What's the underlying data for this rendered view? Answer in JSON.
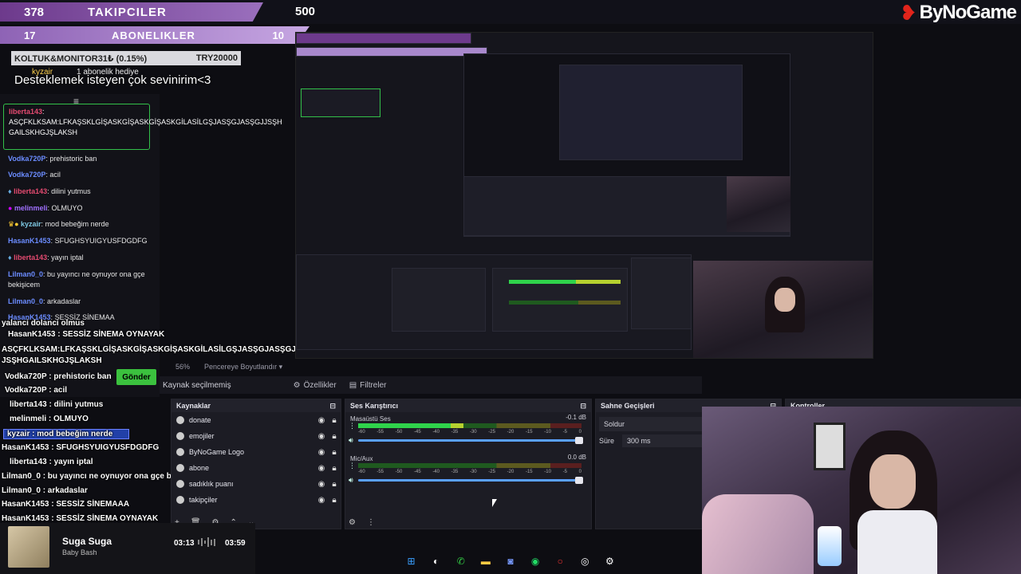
{
  "stats": {
    "followers_count": "378",
    "followers_title": "TAKIPCILER",
    "followers_goal": "500",
    "subs_count": "17",
    "subs_title": "ABONELIKLER",
    "subs_goal": "10"
  },
  "brand": {
    "name": "ByNoGame"
  },
  "donation": {
    "label": "KOLTUK&MONITOR31₺ (0.15%)",
    "target": "TRY20000",
    "message": "Desteklemek isteyen çok sevinirim<3",
    "gift_user": "kyzair",
    "gift_text": "1 abonelik hediye"
  },
  "chat": {
    "highlight": {
      "user": "liberta143",
      "text": "ASÇFKLKSAM:LFKAŞSKLGİŞASKGİŞASKGİŞASKGİLASİLGŞJASŞGJASŞGJJSŞH GAILSKHGJŞLAKSH"
    },
    "lines": [
      {
        "user": "Vodka720P",
        "text": "prehistoric ban"
      },
      {
        "user": "Vodka720P",
        "text": "acil"
      },
      {
        "user": "liberta143",
        "text": "dilini yutmus"
      },
      {
        "user": "melinmeli",
        "text": "OLMUYO"
      },
      {
        "user": "kyzair",
        "text": "mod bebeğim nerde"
      },
      {
        "user": "HasanK1453",
        "text": "SFUGHSYUIGYUSFDGDFG"
      },
      {
        "user": "liberta143",
        "text": "yayın iptal"
      },
      {
        "user": "Lilman0_0",
        "text": "bu yayıncı ne oynuyor ona gçe bekişicem"
      },
      {
        "user": "Lilman0_0",
        "text": "arkadaslar"
      },
      {
        "user": "HasanK1453",
        "text": "SESSİZ SİNEMAA"
      }
    ],
    "overlay": [
      "yalanci dolanci olmus",
      "HasanK1453 : SESSİZ SİNEMA OYNAYAK",
      "ASÇFKLKSAM:LFKAŞSKLGİŞASKGİŞASKGİŞASKGİLASİLGŞJASŞGJASŞGJ",
      "JSŞHGAILSKHGJŞLAKSH",
      "Vodka720P : prehistoric ban",
      "Vodka720P : acil",
      "liberta143 : dilini yutmus",
      "melinmeli : OLMUYO",
      "kyzair : mod bebeğim nerde",
      "HasanK1453 : SFUGHSYUIGYUSFDGDFG",
      "liberta143 : yayın iptal",
      "Lilman0_0 : bu yayıncı ne oynuyor ona gçe bekişicem",
      "Lilman0_0 : arkadaslar",
      "HasanK1453 : SESSİZ SİNEMAAA",
      "HasanK1453 : SESSİZ SİNEMA OYNAYAK"
    ],
    "send_label": "Gönder"
  },
  "obs": {
    "zoom": "56%",
    "window_fit": "Pencereye Boyutlandır",
    "no_source": "Kaynak seçilmemiş",
    "properties": "Özellikler",
    "filters": "Filtreler",
    "sources_title": "Kaynaklar",
    "sources": [
      "donate",
      "emojiler",
      "ByNoGame Logo",
      "abone",
      "sadıklık puanı",
      "takipçiler"
    ],
    "mixer_title": "Ses Karıştırıcı",
    "channels": [
      {
        "name": "Masaüstü Ses",
        "db": "-0.1 dB",
        "level": 0.47
      },
      {
        "name": "Mic/Aux",
        "db": "0.0 dB",
        "level": 0.0
      }
    ],
    "scale": [
      "-60",
      "-55",
      "-50",
      "-45",
      "-40",
      "-35",
      "-30",
      "-25",
      "-20",
      "-15",
      "-10",
      "-5",
      "0"
    ],
    "transitions_title": "Sahne Geçişleri",
    "transition_value": "Soldur",
    "duration_label": "Süre",
    "duration_value": "300 ms",
    "controls_title": "Kontroller"
  },
  "music": {
    "song": "Suga Suga",
    "artist": "Baby Bash",
    "elapsed": "03:13",
    "total": "03:59"
  },
  "colors": {
    "accent": "#3bc13e",
    "brand": "#e2241b",
    "follow_bar": "#7b4a9e"
  }
}
